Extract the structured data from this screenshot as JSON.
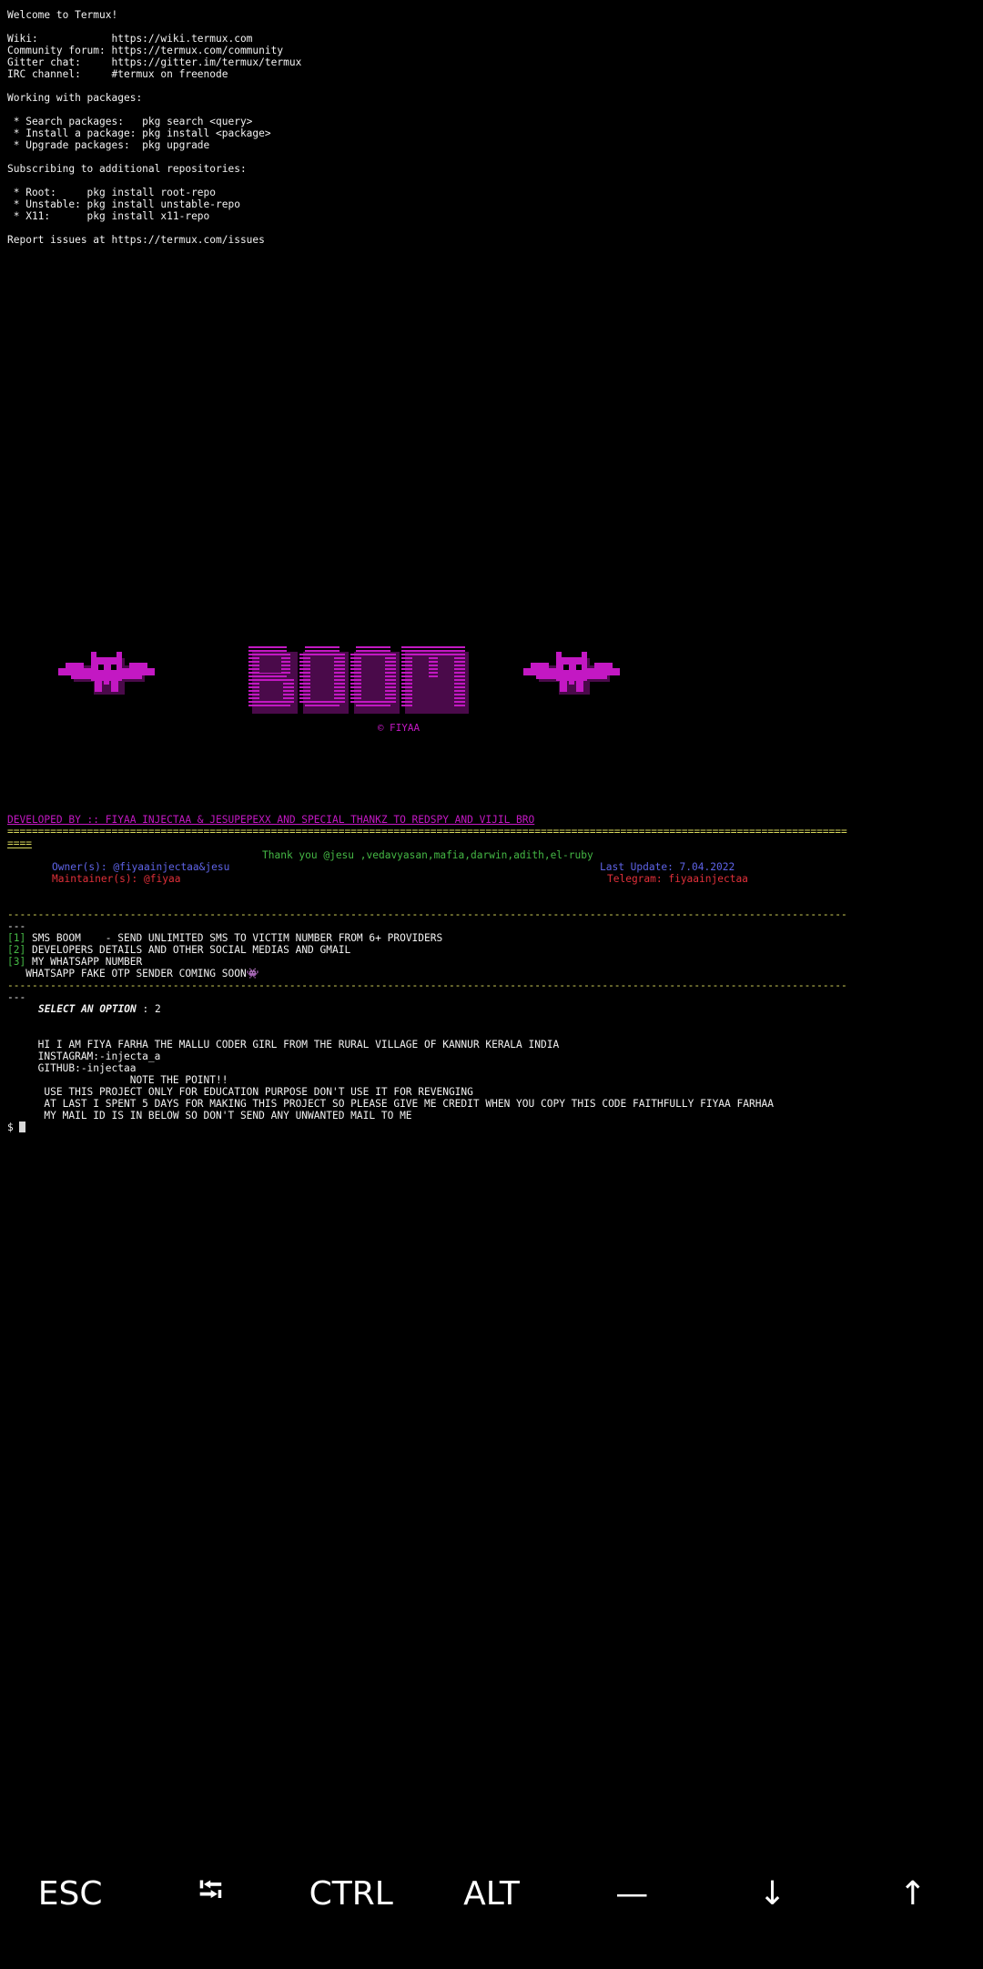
{
  "welcome": {
    "title": "Welcome to Termux!",
    "lines": [
      "Wiki:            https://wiki.termux.com",
      "Community forum: https://termux.com/community",
      "Gitter chat:     https://gitter.im/termux/termux",
      "IRC channel:     #termux on freenode"
    ],
    "packages_heading": "Working with packages:",
    "packages": [
      " * Search packages:   pkg search <query>",
      " * Install a package: pkg install <package>",
      " * Upgrade packages:  pkg upgrade"
    ],
    "repos_heading": "Subscribing to additional repositories:",
    "repos": [
      " * Root:     pkg install root-repo",
      " * Unstable: pkg install unstable-repo",
      " * X11:      pkg install x11-repo"
    ],
    "report": "Report issues at https://termux.com/issues"
  },
  "banner": {
    "title": "BOOM",
    "copyright": "© FIYAA"
  },
  "tool": {
    "developed_by": "DEVELOPED BY :: FIYAA INJECTAA & JESUPEPEXX AND SPECIAL THANKZ TO REDSPY AND VIJIL BRO",
    "divider": "=========================================================================================================================================",
    "divider_tail": "====",
    "thanks": "Thank you @jesu ,vedavyasan,mafia,darwin,adith,el-ruby",
    "owner": "Owner(s): @fiyaainjectaa&jesu",
    "last_update": "Last Update: 7.04.2022",
    "maintainer": "Maintainer(s): @fiyaa",
    "telegram": "Telegram: fiyaainjectaa",
    "dash_divider": "-----------------------------------------------------------------------------------------------------------------------------------------",
    "dash_tail": "---",
    "menu": [
      {
        "num": "[1]",
        "text": " SMS BOOM    - SEND UNLIMITED SMS TO VICTIM NUMBER FROM 6+ PROVIDERS"
      },
      {
        "num": "[2]",
        "text": " DEVELOPERS DETAILS AND OTHER SOCIAL MEDIAS AND GMAIL"
      },
      {
        "num": "[3]",
        "text": " MY WHATSAPP NUMBER"
      }
    ],
    "coming_soon": "   WHATSAPP FAKE OTP SENDER COMING SOON",
    "coming_soon_glyph": "👾",
    "select_label": "SELECT AN OPTION",
    "select_value": " : 2",
    "info": [
      "     HI I AM FIYA FARHA THE MALLU CODER GIRL FROM THE RURAL VILLAGE OF KANNUR KERALA INDIA",
      "     INSTAGRAM:-injecta_a",
      "     GITHUB:-injectaa",
      "                    NOTE THE POINT!!",
      "      USE THIS PROJECT ONLY FOR EDUCATION PURPOSE DON'T USE IT FOR REVENGING",
      "      AT LAST I SPENT 5 DAYS FOR MAKING THIS PROJECT SO PLEASE GIVE ME CREDIT WHEN YOU COPY THIS CODE FAITHFULLY FIYAA FARHAA",
      "      MY MAIL ID IS IN BELOW SO DON'T SEND ANY UNWANTED MAIL TO ME"
    ],
    "prompt": "$ "
  },
  "extra_keys": [
    "ESC",
    "⭾",
    "CTRL",
    "ALT",
    "—",
    "↓",
    "↑"
  ],
  "colors": {
    "magenta": "#c318c3",
    "green": "#45b845",
    "blue": "#5e63e6",
    "red": "#e0303a",
    "yellow": "#d7d75b"
  }
}
